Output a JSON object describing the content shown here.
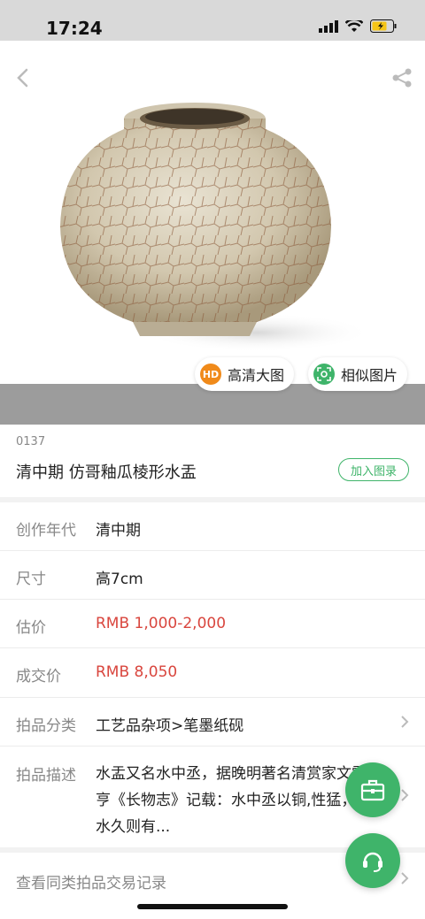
{
  "status": {
    "time": "17:24"
  },
  "hero": {
    "hd_label": "高清大图",
    "hd_badge": "HD",
    "similar_label": "相似图片"
  },
  "lot": {
    "number": "0137",
    "title": "清中期 仿哥釉瓜棱形水盂",
    "add_catalog_label": "加入图录"
  },
  "details": [
    {
      "label": "创作年代",
      "value": "清中期"
    },
    {
      "label": "尺寸",
      "value": "高7cm"
    },
    {
      "label": "估价",
      "value": "RMB  1,000-2,000"
    },
    {
      "label": "成交价",
      "value": "RMB 8,050"
    },
    {
      "label": "拍品分类",
      "value": "工艺品杂项>笔墨纸砚"
    }
  ],
  "description": {
    "label": "拍品描述",
    "text": "水盂又名水中丞，据晚明著名清赏家文震亨《长物志》记载：水中丞以铜,性猛，贮水久则有..."
  },
  "bottom_link": {
    "label": "查看同类拍品交易记录"
  },
  "colors": {
    "accent": "#3fb46a",
    "price_red": "#d9463e",
    "hd_orange": "#f08a1a"
  }
}
